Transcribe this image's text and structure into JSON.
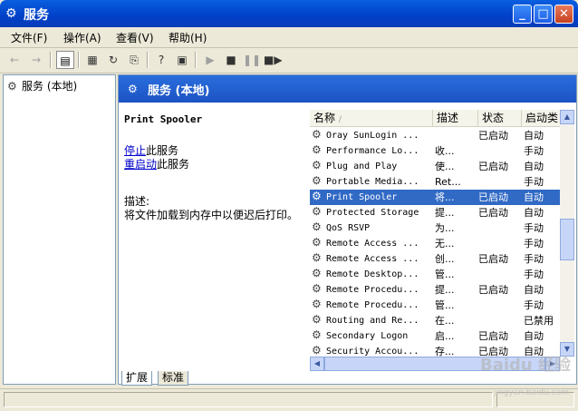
{
  "window": {
    "title": "服务"
  },
  "menu": [
    "文件(F)",
    "操作(A)",
    "查看(V)",
    "帮助(H)"
  ],
  "tree": {
    "root_label": "服务 (本地)"
  },
  "banner": {
    "title": "服务 (本地)"
  },
  "description_panel": {
    "service_name": "Print Spooler",
    "stop_link_text": "停止",
    "stop_suffix": "此服务",
    "restart_link_text": "重启动",
    "restart_suffix": "此服务",
    "desc_label": "描述:",
    "desc_text": "将文件加载到内存中以便迟后打印。"
  },
  "list": {
    "columns": [
      "名称",
      "描述",
      "状态",
      "启动类"
    ],
    "rows": [
      {
        "name": "Oray SunLogin ...",
        "desc": "",
        "status": "已启动",
        "startup": "自动"
      },
      {
        "name": "Performance Lo...",
        "desc": "收...",
        "status": "",
        "startup": "手动"
      },
      {
        "name": "Plug and Play",
        "desc": "使...",
        "status": "已启动",
        "startup": "自动"
      },
      {
        "name": "Portable Media...",
        "desc": "Ret...",
        "status": "",
        "startup": "手动"
      },
      {
        "name": "Print Spooler",
        "desc": "将...",
        "status": "已启动",
        "startup": "自动"
      },
      {
        "name": "Protected Storage",
        "desc": "提...",
        "status": "已启动",
        "startup": "自动"
      },
      {
        "name": "QoS RSVP",
        "desc": "为...",
        "status": "",
        "startup": "手动"
      },
      {
        "name": "Remote Access ...",
        "desc": "无...",
        "status": "",
        "startup": "手动"
      },
      {
        "name": "Remote Access ...",
        "desc": "创...",
        "status": "已启动",
        "startup": "手动"
      },
      {
        "name": "Remote Desktop...",
        "desc": "管...",
        "status": "",
        "startup": "手动"
      },
      {
        "name": "Remote Procedu...",
        "desc": "提...",
        "status": "已启动",
        "startup": "自动"
      },
      {
        "name": "Remote Procedu...",
        "desc": "管...",
        "status": "",
        "startup": "手动"
      },
      {
        "name": "Routing and Re...",
        "desc": "在...",
        "status": "",
        "startup": "已禁用"
      },
      {
        "name": "Secondary Logon",
        "desc": "启...",
        "status": "已启动",
        "startup": "自动"
      },
      {
        "name": "Security Accou...",
        "desc": "存...",
        "status": "已启动",
        "startup": "自动"
      }
    ],
    "selected_name": "Print Spooler"
  },
  "tabs": [
    "扩展",
    "标准"
  ],
  "active_tab": "扩展",
  "colors": {
    "title_blue": "#0A5FE0",
    "selection": "#316AC5",
    "link": "#0000CC"
  },
  "watermark": {
    "logo": "Baidu 经验",
    "url": "jingyan.baidu.com"
  }
}
